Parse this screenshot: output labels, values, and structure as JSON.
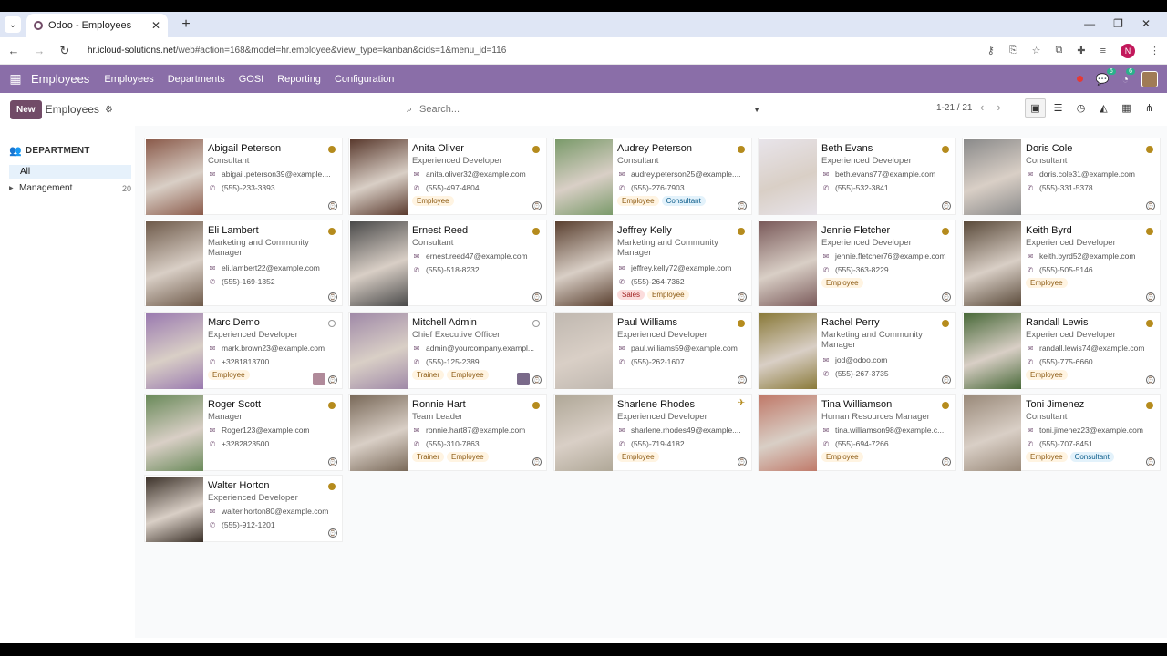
{
  "browser": {
    "tab_title": "Odoo - Employees",
    "url_host": "hr.icloud-solutions.net",
    "url_path": "/web#action=168&model=hr.employee&view_type=kanban&cids=1&menu_id=116",
    "profile_initial": "N"
  },
  "navbar": {
    "app_name": "Employees",
    "menu": [
      "Employees",
      "Departments",
      "GOSI",
      "Reporting",
      "Configuration"
    ],
    "chat_badge": "6",
    "activity_badge": "6"
  },
  "control": {
    "new_label": "New",
    "breadcrumb": "Employees",
    "search_placeholder": "Search...",
    "pager": "1-21 / 21"
  },
  "sidebar": {
    "header": "DEPARTMENT",
    "all_label": "All",
    "items": [
      {
        "label": "Management",
        "count": "20"
      }
    ]
  },
  "colors": {
    "brand": "#714b67",
    "navbar": "#8a6ea8",
    "status": "#b58b1d"
  },
  "employees": [
    {
      "name": "Abigail Peterson",
      "job": "Consultant",
      "email": "abigail.peterson39@example....",
      "phone": "(555)-233-3393",
      "tags": [],
      "photo": "#8a5a4a"
    },
    {
      "name": "Anita Oliver",
      "job": "Experienced Developer",
      "email": "anita.oliver32@example.com",
      "phone": "(555)-497-4804",
      "tags": [
        {
          "t": "Employee",
          "c": ""
        }
      ],
      "photo": "#5a3a2e"
    },
    {
      "name": "Audrey Peterson",
      "job": "Consultant",
      "email": "audrey.peterson25@example....",
      "phone": "(555)-276-7903",
      "tags": [
        {
          "t": "Employee",
          "c": ""
        },
        {
          "t": "Consultant",
          "c": "blue"
        }
      ],
      "photo": "#7a9a6a"
    },
    {
      "name": "Beth Evans",
      "job": "Experienced Developer",
      "email": "beth.evans77@example.com",
      "phone": "(555)-532-3841",
      "tags": [],
      "photo": "#e8e4ea"
    },
    {
      "name": "Doris Cole",
      "job": "Consultant",
      "email": "doris.cole31@example.com",
      "phone": "(555)-331-5378",
      "tags": [],
      "photo": "#8a8a8a"
    },
    {
      "name": "Eli Lambert",
      "job": "Marketing and Community Manager",
      "email": "eli.lambert22@example.com",
      "phone": "(555)-169-1352",
      "tags": [],
      "photo": "#6e5a4a"
    },
    {
      "name": "Ernest Reed",
      "job": "Consultant",
      "email": "ernest.reed47@example.com",
      "phone": "(555)-518-8232",
      "tags": [],
      "photo": "#4a4a4a"
    },
    {
      "name": "Jeffrey Kelly",
      "job": "Marketing and Community Manager",
      "email": "jeffrey.kelly72@example.com",
      "phone": "(555)-264-7362",
      "tags": [
        {
          "t": "Sales",
          "c": "red"
        },
        {
          "t": "Employee",
          "c": ""
        }
      ],
      "photo": "#5a4030"
    },
    {
      "name": "Jennie Fletcher",
      "job": "Experienced Developer",
      "email": "jennie.fletcher76@example.com",
      "phone": "(555)-363-8229",
      "tags": [
        {
          "t": "Employee",
          "c": ""
        }
      ],
      "photo": "#7a5a5a"
    },
    {
      "name": "Keith Byrd",
      "job": "Experienced Developer",
      "email": "keith.byrd52@example.com",
      "phone": "(555)-505-5146",
      "tags": [
        {
          "t": "Employee",
          "c": ""
        }
      ],
      "photo": "#5a4a3a"
    },
    {
      "name": "Marc Demo",
      "job": "Experienced Developer",
      "email": "mark.brown23@example.com",
      "phone": "+3281813700",
      "tags": [
        {
          "t": "Employee",
          "c": ""
        }
      ],
      "photo": "#9a7ab0",
      "status": "empty",
      "mini": "#b08a9a"
    },
    {
      "name": "Mitchell Admin",
      "job": "Chief Executive Officer",
      "email": "admin@yourcompany.exampl...",
      "phone": "(555)-125-2389",
      "tags": [
        {
          "t": "Trainer",
          "c": ""
        },
        {
          "t": "Employee",
          "c": ""
        }
      ],
      "photo": "#a08aa8",
      "status": "empty",
      "mini": "#7a6a8a"
    },
    {
      "name": "Paul Williams",
      "job": "Experienced Developer",
      "email": "paul.williams59@example.com",
      "phone": "(555)-262-1607",
      "tags": [],
      "photo": "#c0b8b0"
    },
    {
      "name": "Rachel Perry",
      "job": "Marketing and Community Manager",
      "email": "jod@odoo.com",
      "phone": "(555)-267-3735",
      "tags": [],
      "photo": "#8a7a3a"
    },
    {
      "name": "Randall Lewis",
      "job": "Experienced Developer",
      "email": "randall.lewis74@example.com",
      "phone": "(555)-775-6660",
      "tags": [
        {
          "t": "Employee",
          "c": ""
        }
      ],
      "photo": "#4a6a3a"
    },
    {
      "name": "Roger Scott",
      "job": "Manager",
      "email": "Roger123@example.com",
      "phone": "+3282823500",
      "tags": [],
      "photo": "#6a8a5a"
    },
    {
      "name": "Ronnie Hart",
      "job": "Team Leader",
      "email": "ronnie.hart87@example.com",
      "phone": "(555)-310-7863",
      "tags": [
        {
          "t": "Trainer",
          "c": ""
        },
        {
          "t": "Employee",
          "c": ""
        }
      ],
      "photo": "#7a6a5a"
    },
    {
      "name": "Sharlene Rhodes",
      "job": "Experienced Developer",
      "email": "sharlene.rhodes49@example....",
      "phone": "(555)-719-4182",
      "tags": [
        {
          "t": "Employee",
          "c": ""
        }
      ],
      "photo": "#b0a898",
      "status": "plane"
    },
    {
      "name": "Tina Williamson",
      "job": "Human Resources Manager",
      "email": "tina.williamson98@example.c...",
      "phone": "(555)-694-7266",
      "tags": [
        {
          "t": "Employee",
          "c": ""
        }
      ],
      "photo": "#c07a6a"
    },
    {
      "name": "Toni Jimenez",
      "job": "Consultant",
      "email": "toni.jimenez23@example.com",
      "phone": "(555)-707-8451",
      "tags": [
        {
          "t": "Employee",
          "c": ""
        },
        {
          "t": "Consultant",
          "c": "blue"
        }
      ],
      "photo": "#9a8a7a"
    },
    {
      "name": "Walter Horton",
      "job": "Experienced Developer",
      "email": "walter.horton80@example.com",
      "phone": "(555)-912-1201",
      "tags": [],
      "photo": "#3a3028"
    }
  ]
}
